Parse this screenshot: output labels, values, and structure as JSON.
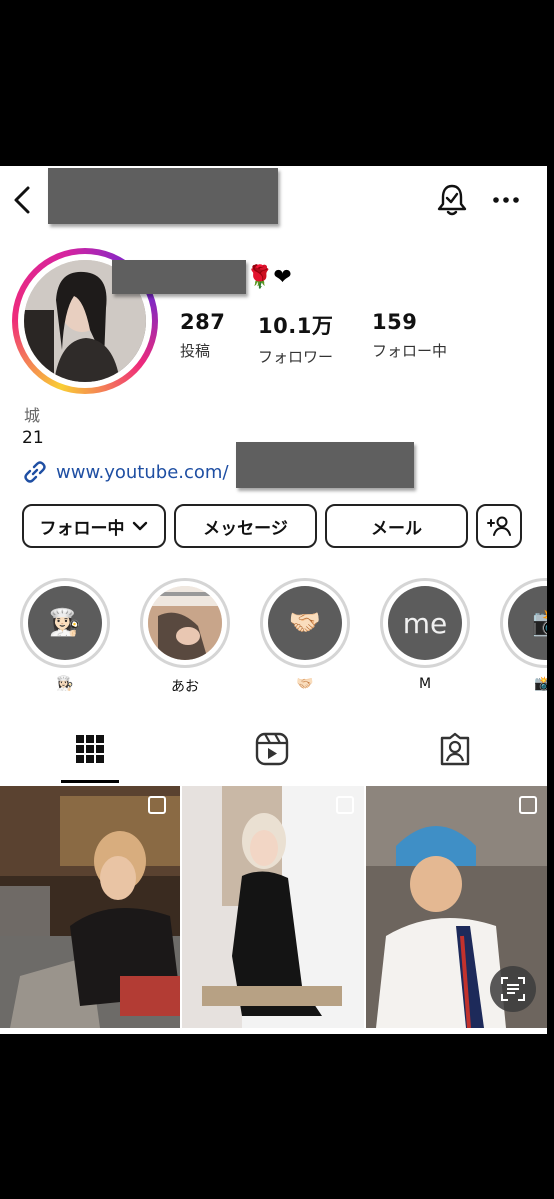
{
  "profile": {
    "name_emoji": "🌹❤",
    "stats": [
      {
        "value": "287",
        "label": "投稿"
      },
      {
        "value": "10.1万",
        "label": "フォロワー"
      },
      {
        "value": "159",
        "label": "フォロー中"
      }
    ],
    "bio_line1": "城",
    "bio_line2": "21",
    "link_text": "www.youtube.com/"
  },
  "buttons": {
    "following": "フォロー中",
    "message": "メッセージ",
    "mail": "メール"
  },
  "highlights": [
    {
      "label": "👩🏻‍🍳",
      "icon": "👩🏻‍🍳"
    },
    {
      "label": "あお",
      "icon": ""
    },
    {
      "label": "🤝🏻",
      "icon": "🤝🏻"
    },
    {
      "label": "M",
      "icon": "me"
    },
    {
      "label": "📸",
      "icon": "📸"
    }
  ],
  "tabs": [
    "posts-grid-icon",
    "reels-icon",
    "tagged-icon"
  ],
  "colors": {
    "link": "#1f4fa3",
    "redaction": "#5f5f5f"
  }
}
